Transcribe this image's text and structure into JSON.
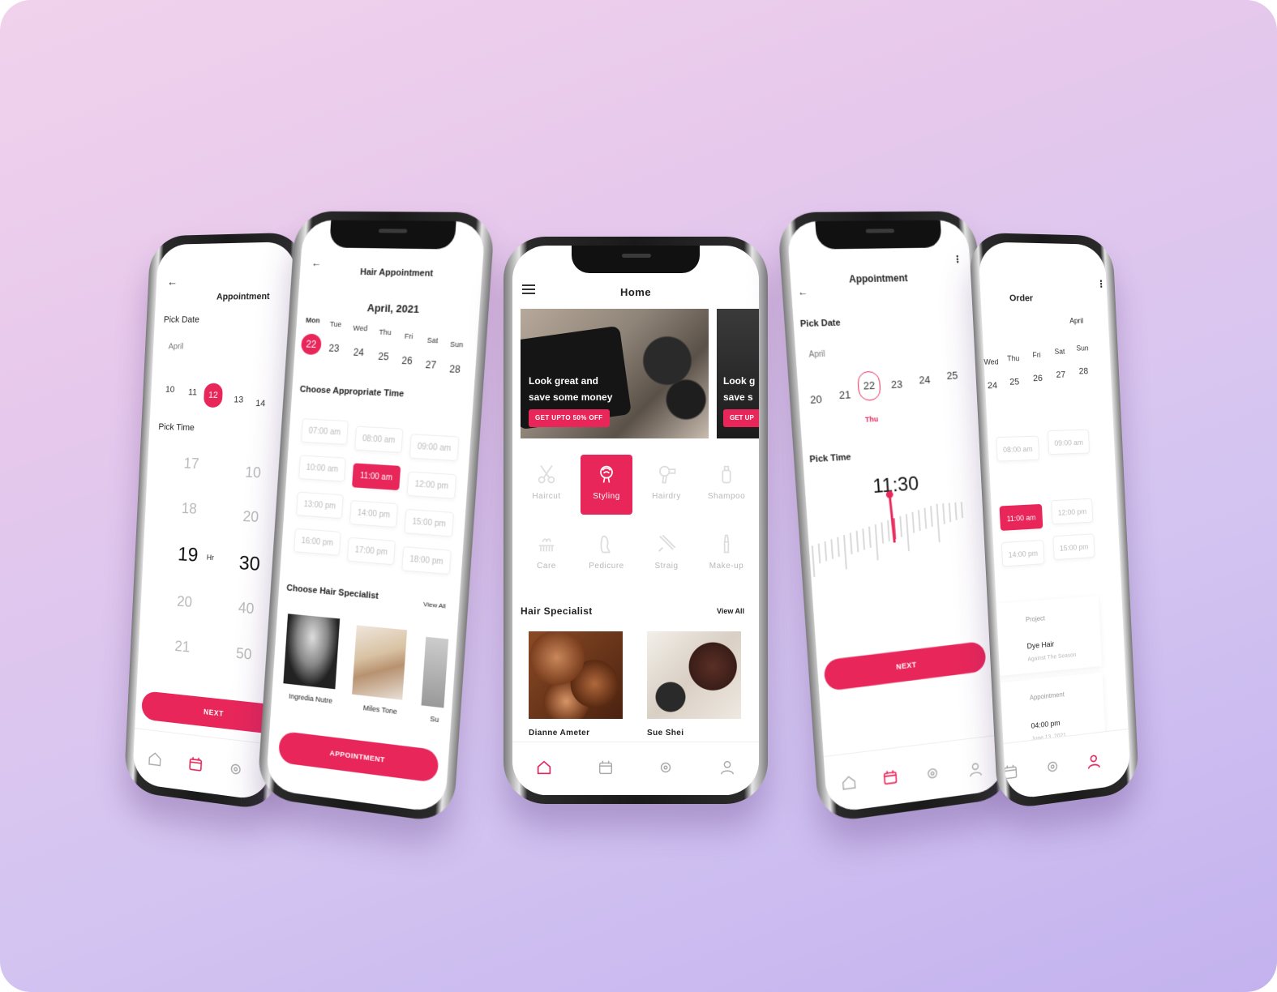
{
  "colors": {
    "accent": "#e8265a",
    "bg_top": "#f1d2ec",
    "bg_bottom": "#c3b2ee"
  },
  "phone1": {
    "title": "Appointment",
    "pick_date": "Pick Date",
    "month": "April",
    "dates": [
      "10",
      "11",
      "12",
      "13",
      "14"
    ],
    "selected_date": "12",
    "pick_time": "Pick Time",
    "hours": [
      "17",
      "18",
      "19",
      "20",
      "21"
    ],
    "minutes": [
      "10",
      "20",
      "30",
      "40",
      "50"
    ],
    "hr_label": "Hr",
    "next": "NEXT"
  },
  "phone2": {
    "title": "Hair Appointment",
    "month_year": "April, 2021",
    "weekdays": [
      "Mon",
      "Tue",
      "Wed",
      "Thu",
      "Fri",
      "Sat",
      "Sun"
    ],
    "days": [
      "22",
      "23",
      "24",
      "25",
      "26",
      "27",
      "28"
    ],
    "choose_time": "Choose Appropriate Time",
    "slots": [
      "07:00 am",
      "08:00 am",
      "09:00 am",
      "10:00 am",
      "11:00 am",
      "12:00 pm",
      "13:00 pm",
      "14:00 pm",
      "15:00 pm",
      "16:00 pm",
      "17:00 pm",
      "18:00 pm"
    ],
    "choose_specialist": "Choose Hair Specialist",
    "view_all": "View All",
    "specialists": [
      "Ingredia Nutre",
      "Miles Tone",
      "Su"
    ],
    "appointment": "APPOINTMENT"
  },
  "phone3": {
    "title": "Home",
    "banner_text_1": "Look great and",
    "banner_text_2": "save some money",
    "banner_cta": "GET UPTO 50% OFF",
    "banner2_text_1": "Look g",
    "banner2_text_2": "save s",
    "banner2_cta": "GET UP",
    "categories": [
      "Haircut",
      "Styling",
      "Hairdry",
      "Shampoo",
      "Care",
      "Pedicure",
      "Straig",
      "Make-up"
    ],
    "selected_category": "Styling",
    "hair_specialist": "Hair Specialist",
    "view_all": "View All",
    "specialists": [
      "Dianne Ameter",
      "Sue Shei"
    ]
  },
  "phone4": {
    "title": "Appointment",
    "pick_date": "Pick Date",
    "month": "April",
    "dates": [
      "20",
      "21",
      "22",
      "23",
      "24",
      "25"
    ],
    "selected_day_label": "Thu",
    "pick_time": "Pick Time",
    "time": "11:30",
    "next": "NEXT"
  },
  "phone5": {
    "title": "Order",
    "month": "April",
    "weekdays": [
      "Wed",
      "Thu",
      "Fri",
      "Sat",
      "Sun"
    ],
    "days": [
      "24",
      "25",
      "26",
      "27",
      "28"
    ],
    "slots": [
      "08:00 am",
      "09:00 am",
      "11:00 am",
      "12:00 pm",
      "14:00 pm",
      "15:00 pm"
    ],
    "project_label": "Project",
    "project_value": "Dye Hair",
    "project_sub": "Against The Season",
    "appointment_label": "Appointment",
    "appointment_time": "04:00 pm",
    "appointment_date": "June 13, 2021"
  }
}
